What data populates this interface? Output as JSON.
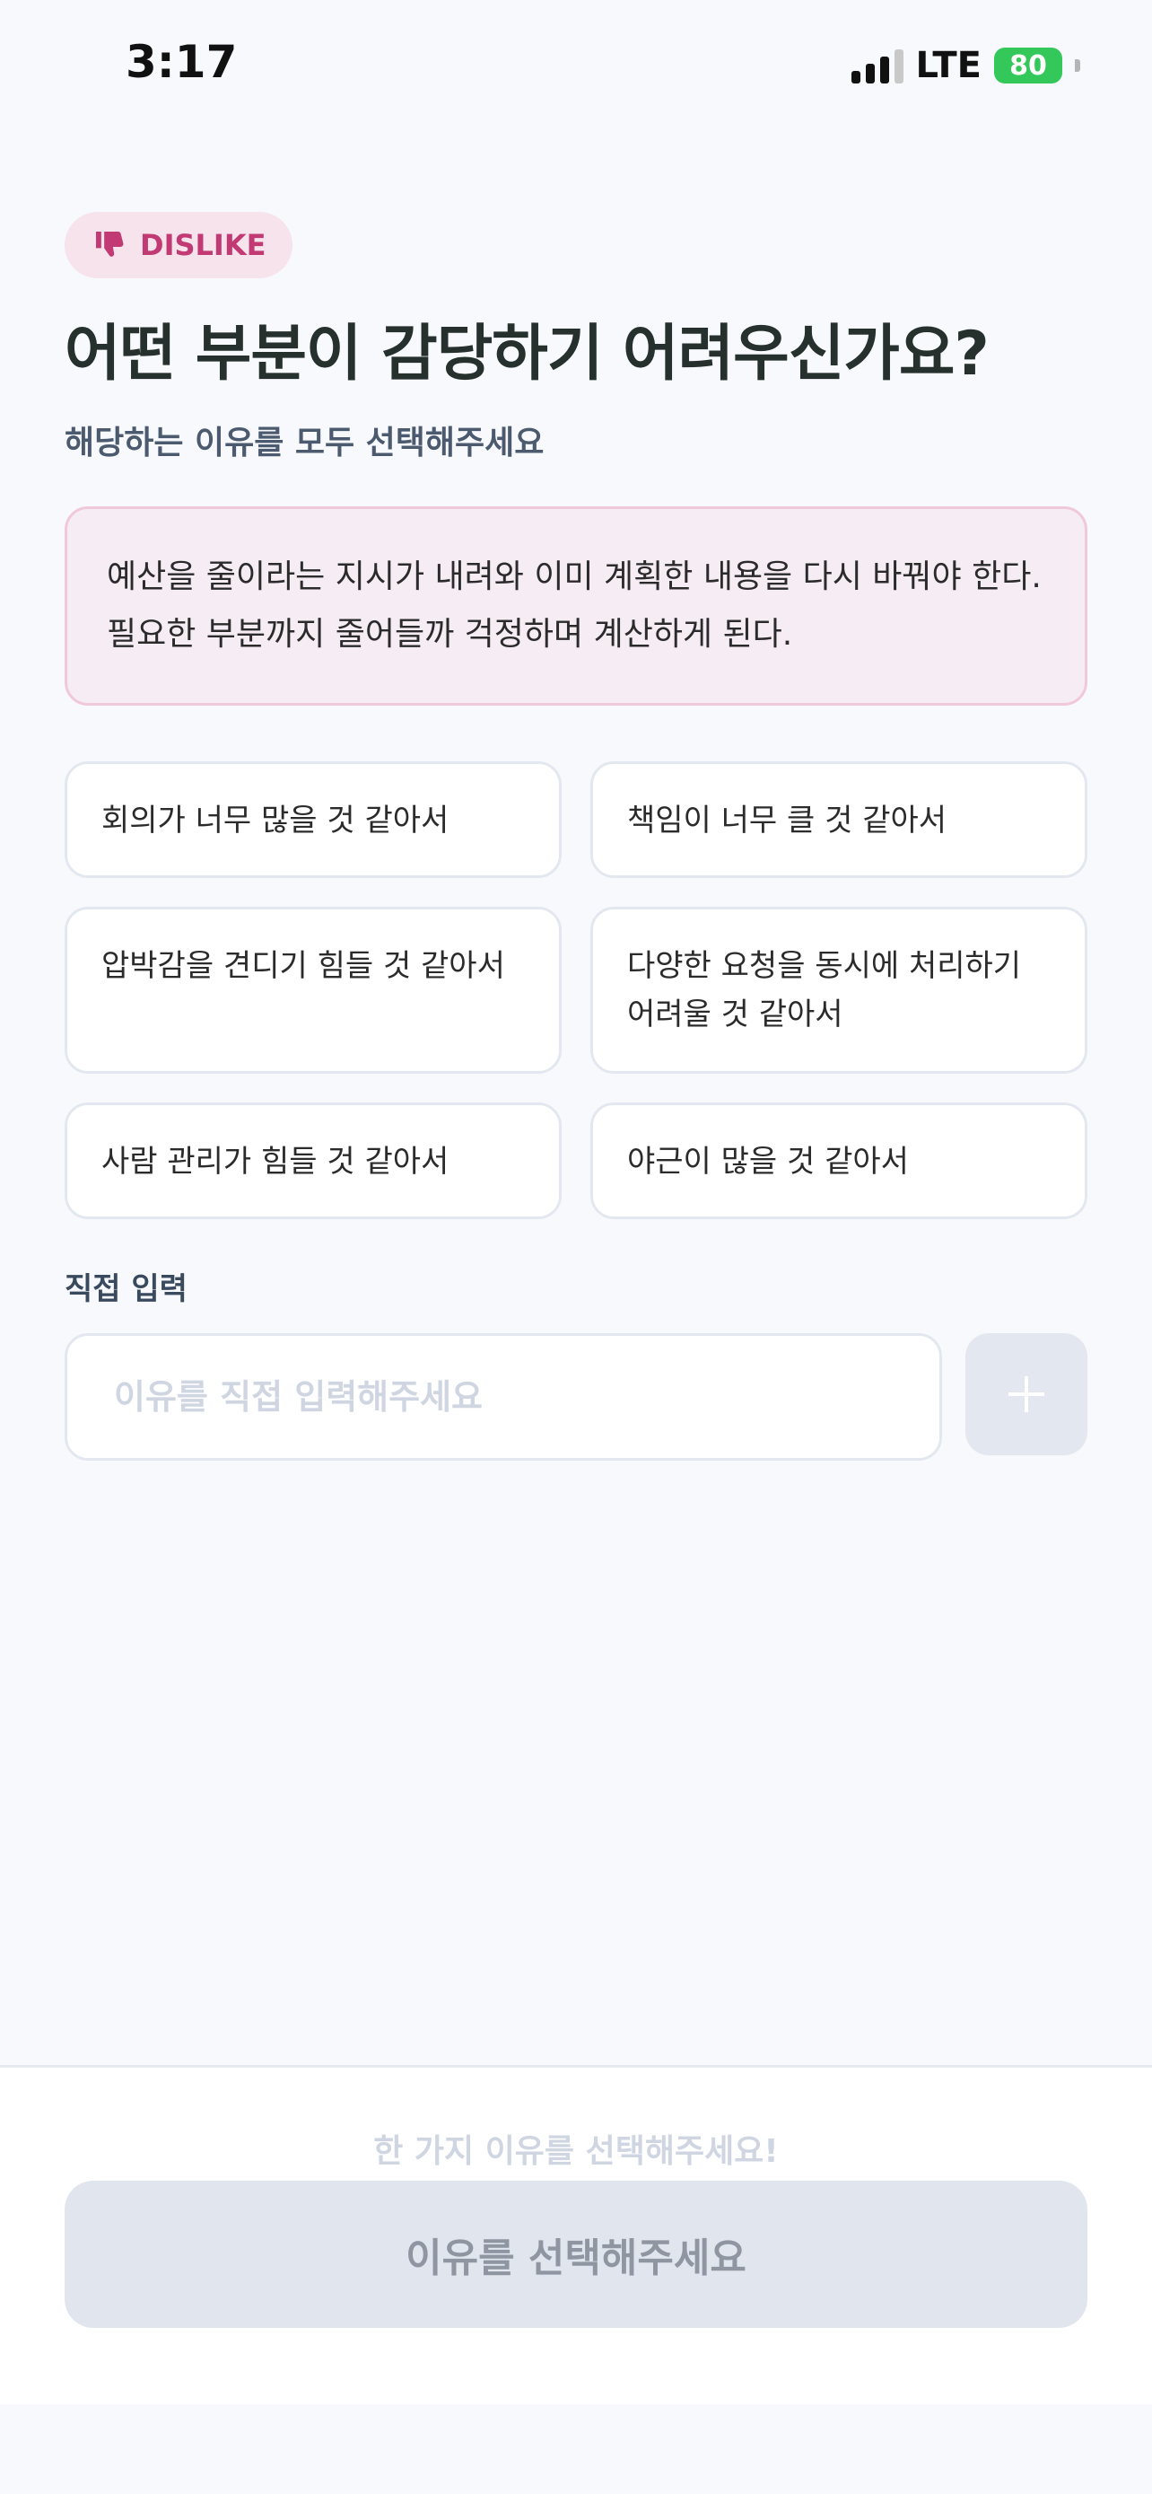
{
  "status_bar": {
    "time": "3:17",
    "network": "LTE",
    "battery": "80"
  },
  "badge": {
    "icon": "thumbs-down-icon",
    "label": "DISLIKE"
  },
  "title": "어떤 부분이 감당하기 어려우신가요?",
  "subtitle": "해당하는 이유를 모두 선택해주세요",
  "situation": "예산을 줄이라는 지시가 내려와 이미 계획한 내용을 다시 바꿔야 한다. 필요한 부분까지 줄어들까 걱정하며 계산하게 된다.",
  "options": [
    "회의가 너무 많을 것 같아서",
    "책임이 너무 클 것 같아서",
    "압박감을 견디기 힘들 것 같아서",
    "다양한 요청을 동시에 처리하기 어려울 것 같아서",
    "사람 관리가 힘들 것 같아서",
    "야근이 많을 것 같아서"
  ],
  "direct_input": {
    "label": "직접 입력",
    "placeholder": "이유를 직접 입력해주세요",
    "add_icon": "plus-icon"
  },
  "bottom": {
    "hint": "한 가지 이유를 선택해주세요!",
    "submit_label": "이유를 선택해주세요"
  },
  "colors": {
    "accent": "#c23a74",
    "badge_bg": "#f6e3ec",
    "situation_bg": "#f6ecf3",
    "situation_border": "#f0c9d9",
    "disabled_bg": "#e1e6ee"
  }
}
